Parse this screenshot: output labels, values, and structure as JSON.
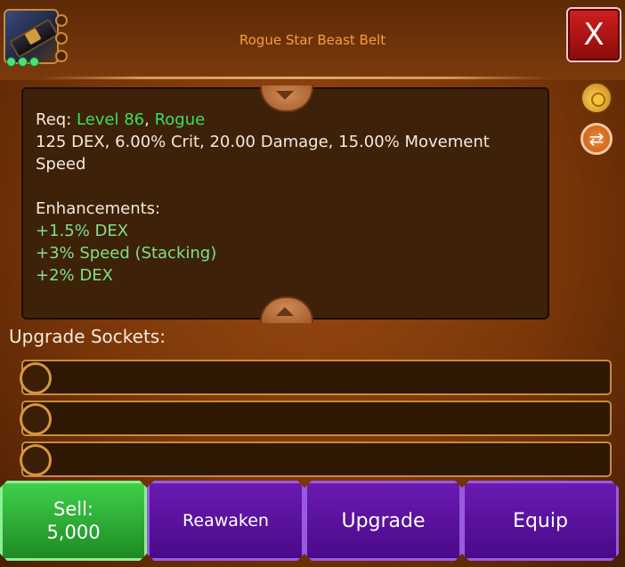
{
  "item": {
    "name": "Rogue Star Beast Belt",
    "gem_slots_filled": 3,
    "gem_color": "#4de07a"
  },
  "close": {
    "label": "X"
  },
  "description": {
    "req_prefix": "Req: ",
    "req_level": "Level 86",
    "req_sep": ", ",
    "req_class": "Rogue",
    "stats": "125 DEX, 6.00% Crit, 20.00 Damage, 15.00% Movement Speed",
    "enhancements_title": "Enhancements:",
    "enhancements": [
      "+1.5% DEX",
      "+3% Speed (Stacking)",
      "+2% DEX"
    ]
  },
  "side_icons": [
    "money-bag-icon",
    "swap-icon"
  ],
  "sockets": {
    "label": "Upgrade Sockets:",
    "count": 3
  },
  "actions": {
    "sell_label": "Sell:",
    "sell_price": "5,000",
    "reawaken_label": "Reawaken",
    "upgrade_label": "Upgrade",
    "equip_label": "Equip"
  }
}
